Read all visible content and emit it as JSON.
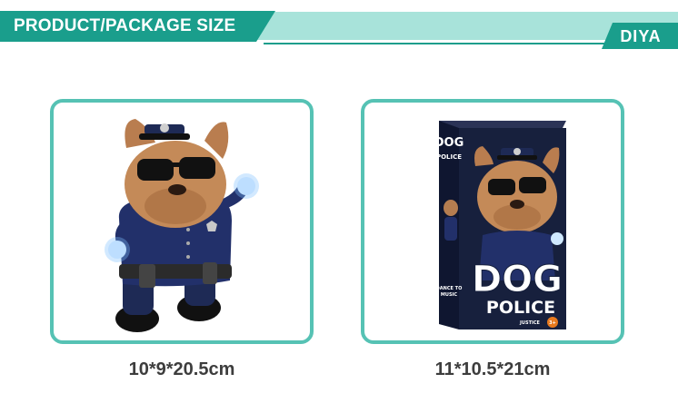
{
  "header": {
    "title": "PRODUCT/PACKAGE SIZE",
    "brand": "DIYA"
  },
  "colors": {
    "teal_dark": "#1a9e8c",
    "teal_light": "#a8e3da",
    "card_border": "#56c2b4",
    "size_text": "#3d3d3d",
    "box_navy": "#17203d"
  },
  "products": [
    {
      "size": "10*9*20.5cm"
    },
    {
      "size": "11*10.5*21cm",
      "box": {
        "side_title_1": "DOG",
        "side_title_2": "POLICE",
        "front_title_1": "DOG",
        "front_title_2": "POLICE",
        "tagline_1": "DANCE TO",
        "tagline_2": "MUSIC",
        "caption": "JUSTICE",
        "age_badge": "3+"
      }
    }
  ]
}
